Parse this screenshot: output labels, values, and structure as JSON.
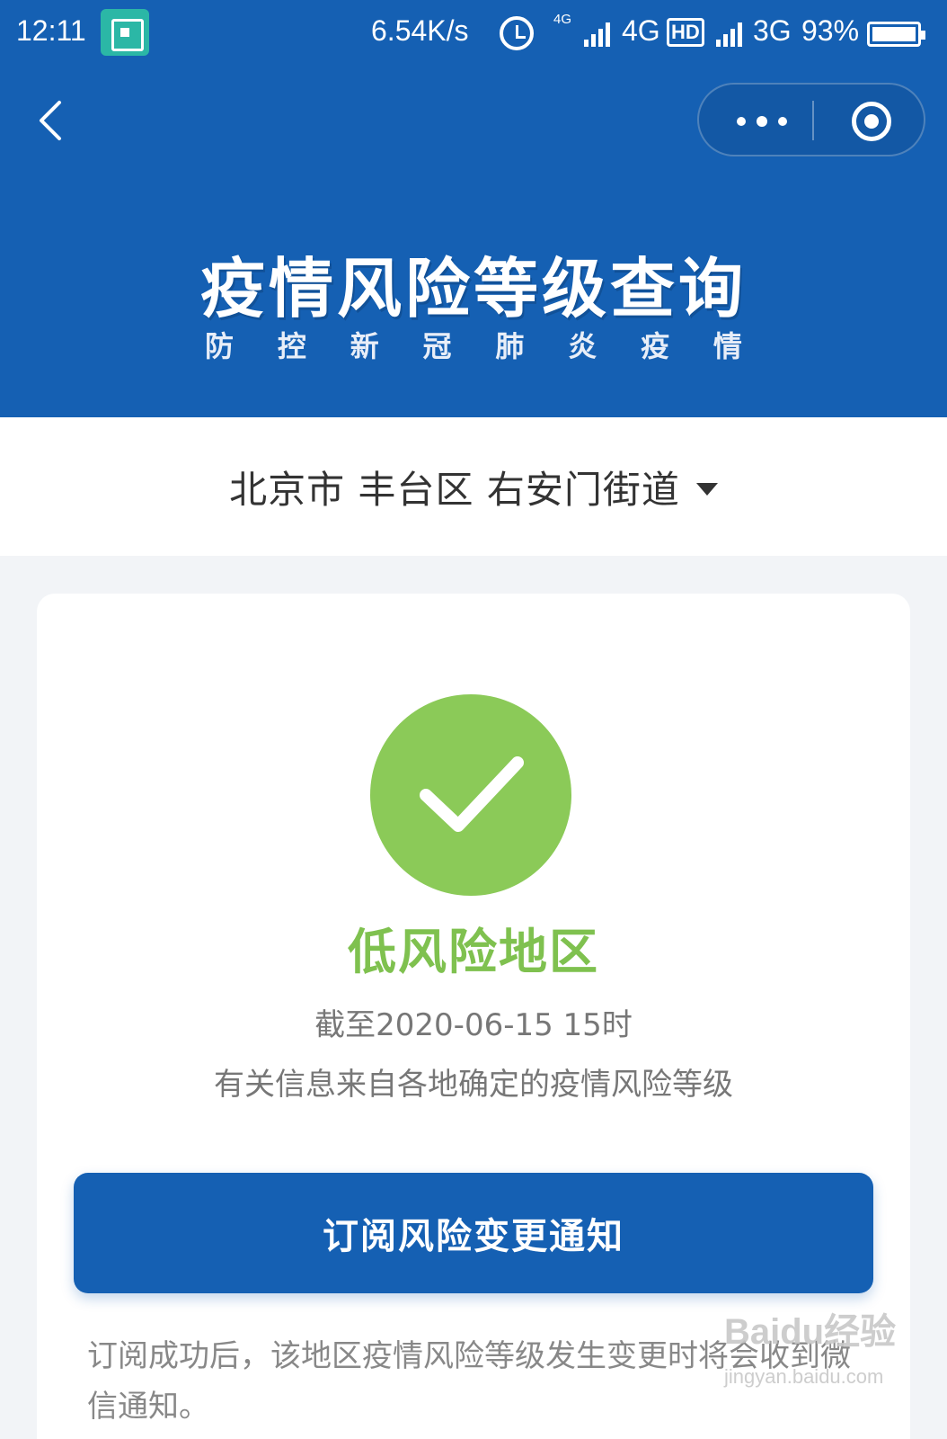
{
  "status_bar": {
    "time": "12:11",
    "speed": "6.54K/s",
    "net_small": "4G",
    "net1": "4G",
    "hd": "HD",
    "net2": "3G",
    "battery": "93%"
  },
  "header": {
    "title": "疫情风险等级查询",
    "subtitle_chars": [
      "防",
      "控",
      "新",
      "冠",
      "肺",
      "炎",
      "疫",
      "情"
    ]
  },
  "location": {
    "text": "北京市 丰台区 右安门街道"
  },
  "result": {
    "level": "低风险地区",
    "as_of": "截至2020-06-15 15时",
    "source_note": "有关信息来自各地确定的疫情风险等级"
  },
  "subscribe": {
    "button_label": "订阅风险变更通知",
    "note": "订阅成功后，该地区疫情风险等级发生变更时将会收到微信通知。"
  },
  "watermark": {
    "main": "Baidu经验",
    "sub": "jingyan.baidu.com"
  },
  "colors": {
    "brand_blue": "#1560b3",
    "low_risk_green": "#8bca58"
  }
}
